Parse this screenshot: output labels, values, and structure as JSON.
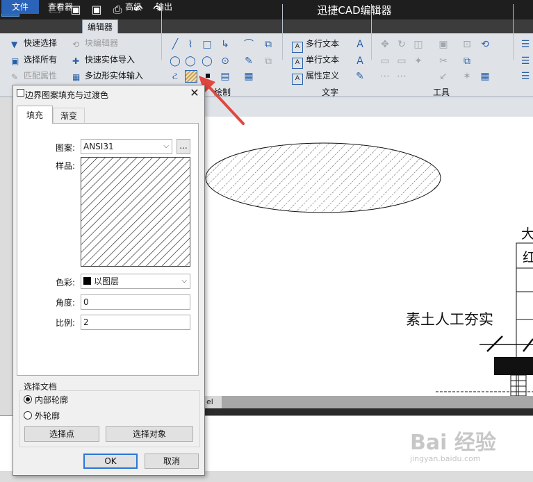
{
  "app": {
    "logo_text": "CAD",
    "title": "迅捷CAD编辑器"
  },
  "ribbon_tabs": [
    "文件",
    "查看器",
    "编辑器",
    "高级",
    "输出"
  ],
  "ribbon": {
    "select_group": {
      "items": [
        "快速选择",
        "选择所有",
        "匹配属性",
        "块编辑器",
        "快速实体导入",
        "多边形实体输入"
      ]
    },
    "draw_group_label": "绘制",
    "text_group": {
      "items": [
        "多行文本",
        "单行文本",
        "属性定义"
      ],
      "label": "文字"
    },
    "tools_group_label": "工具"
  },
  "drawing": {
    "text_label": "素土人工夯实",
    "partial_char_1": "大",
    "partial_char_2": "红",
    "model_tab": "el"
  },
  "dialog": {
    "title": "边界图案填充与过渡色",
    "tabs": [
      "填充",
      "渐变"
    ],
    "pattern_label": "图案:",
    "pattern_value": "ANSI31",
    "more_button": "...",
    "sample_label": "样品:",
    "color_label": "色彩:",
    "color_value": "以图层",
    "angle_label": "角度:",
    "angle_value": "0",
    "scale_label": "比例:",
    "scale_value": "2",
    "select_doc_title": "选择文档",
    "radio_inner": "内部轮廓",
    "radio_outer": "外轮廓",
    "select_point_button": "选择点",
    "select_object_button": "选择对象",
    "ok_button": "OK",
    "cancel_button": "取消"
  },
  "watermark": {
    "text": "Bai 经验",
    "url": "jingyan.baidu.com"
  },
  "colors": {
    "title_bar": "#1e1e1e",
    "file_tab": "#2a63b8",
    "ribbon_bg": "#dfe3e8",
    "arrow": "#e0473f",
    "ok_border": "#2a77d6"
  }
}
